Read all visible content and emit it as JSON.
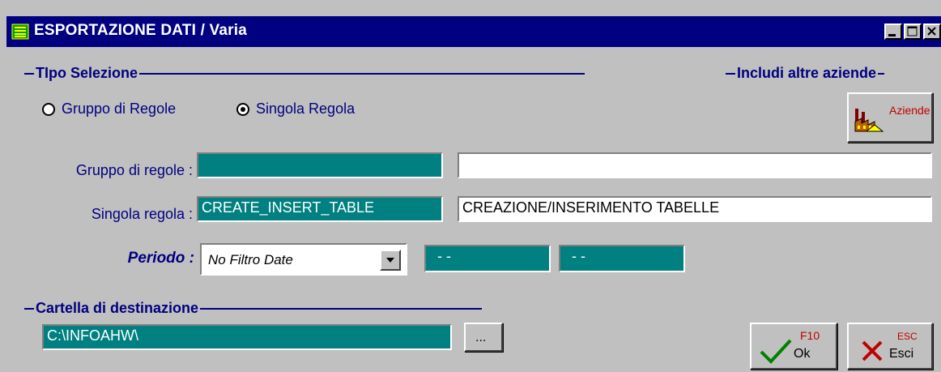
{
  "window": {
    "title": "ESPORTAZIONE DATI / Varia"
  },
  "tipo_selezione": {
    "header": "TIpo Selezione",
    "option_gruppo": "Gruppo di Regole",
    "option_singola": "Singola Regola",
    "selected": "Singola Regola"
  },
  "includi": {
    "header": "Includi altre aziende",
    "aziende_button_label": "Aziende"
  },
  "gruppo_regole": {
    "label": "Gruppo di regole :",
    "code": "",
    "description": ""
  },
  "singola_regola": {
    "label": "Singola regola :",
    "code": "CREATE_INSERT_TABLE",
    "description": "CREAZIONE/INSERIMENTO TABELLE"
  },
  "periodo": {
    "label": "Periodo :",
    "selected": "No Filtro Date",
    "date_from": "- -",
    "date_to": "- -"
  },
  "cartella": {
    "header": "Cartella di destinazione",
    "path": "C:\\INFOAHW\\",
    "browse_label": "..."
  },
  "buttons": {
    "ok_key": "F10",
    "ok_label": "Ok",
    "esci_key": "ESC",
    "esci_label": "Esci"
  },
  "colors": {
    "title_bar": "#000080",
    "field_teal": "#008080",
    "label_text": "#000080",
    "ok_check": "#008000",
    "cancel_x": "#c00000"
  }
}
